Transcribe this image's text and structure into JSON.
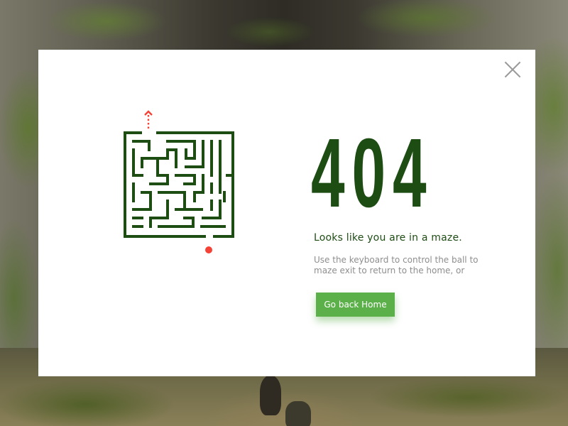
{
  "page": {
    "error_code": "404",
    "headline": "Looks like you are in a maze.",
    "message": "Use the keyboard to control the ball to maze exit to return to the home, or",
    "home_button_label": "Go back Home"
  },
  "colors": {
    "maze_wall": "#1e4d14",
    "ball": "#f44336",
    "button": "#5cb04a",
    "text_primary": "#1e4d14",
    "text_secondary": "#8e8e8e"
  },
  "icons": {
    "close": "close-icon",
    "exit_marker": "arrow-up-icon"
  }
}
